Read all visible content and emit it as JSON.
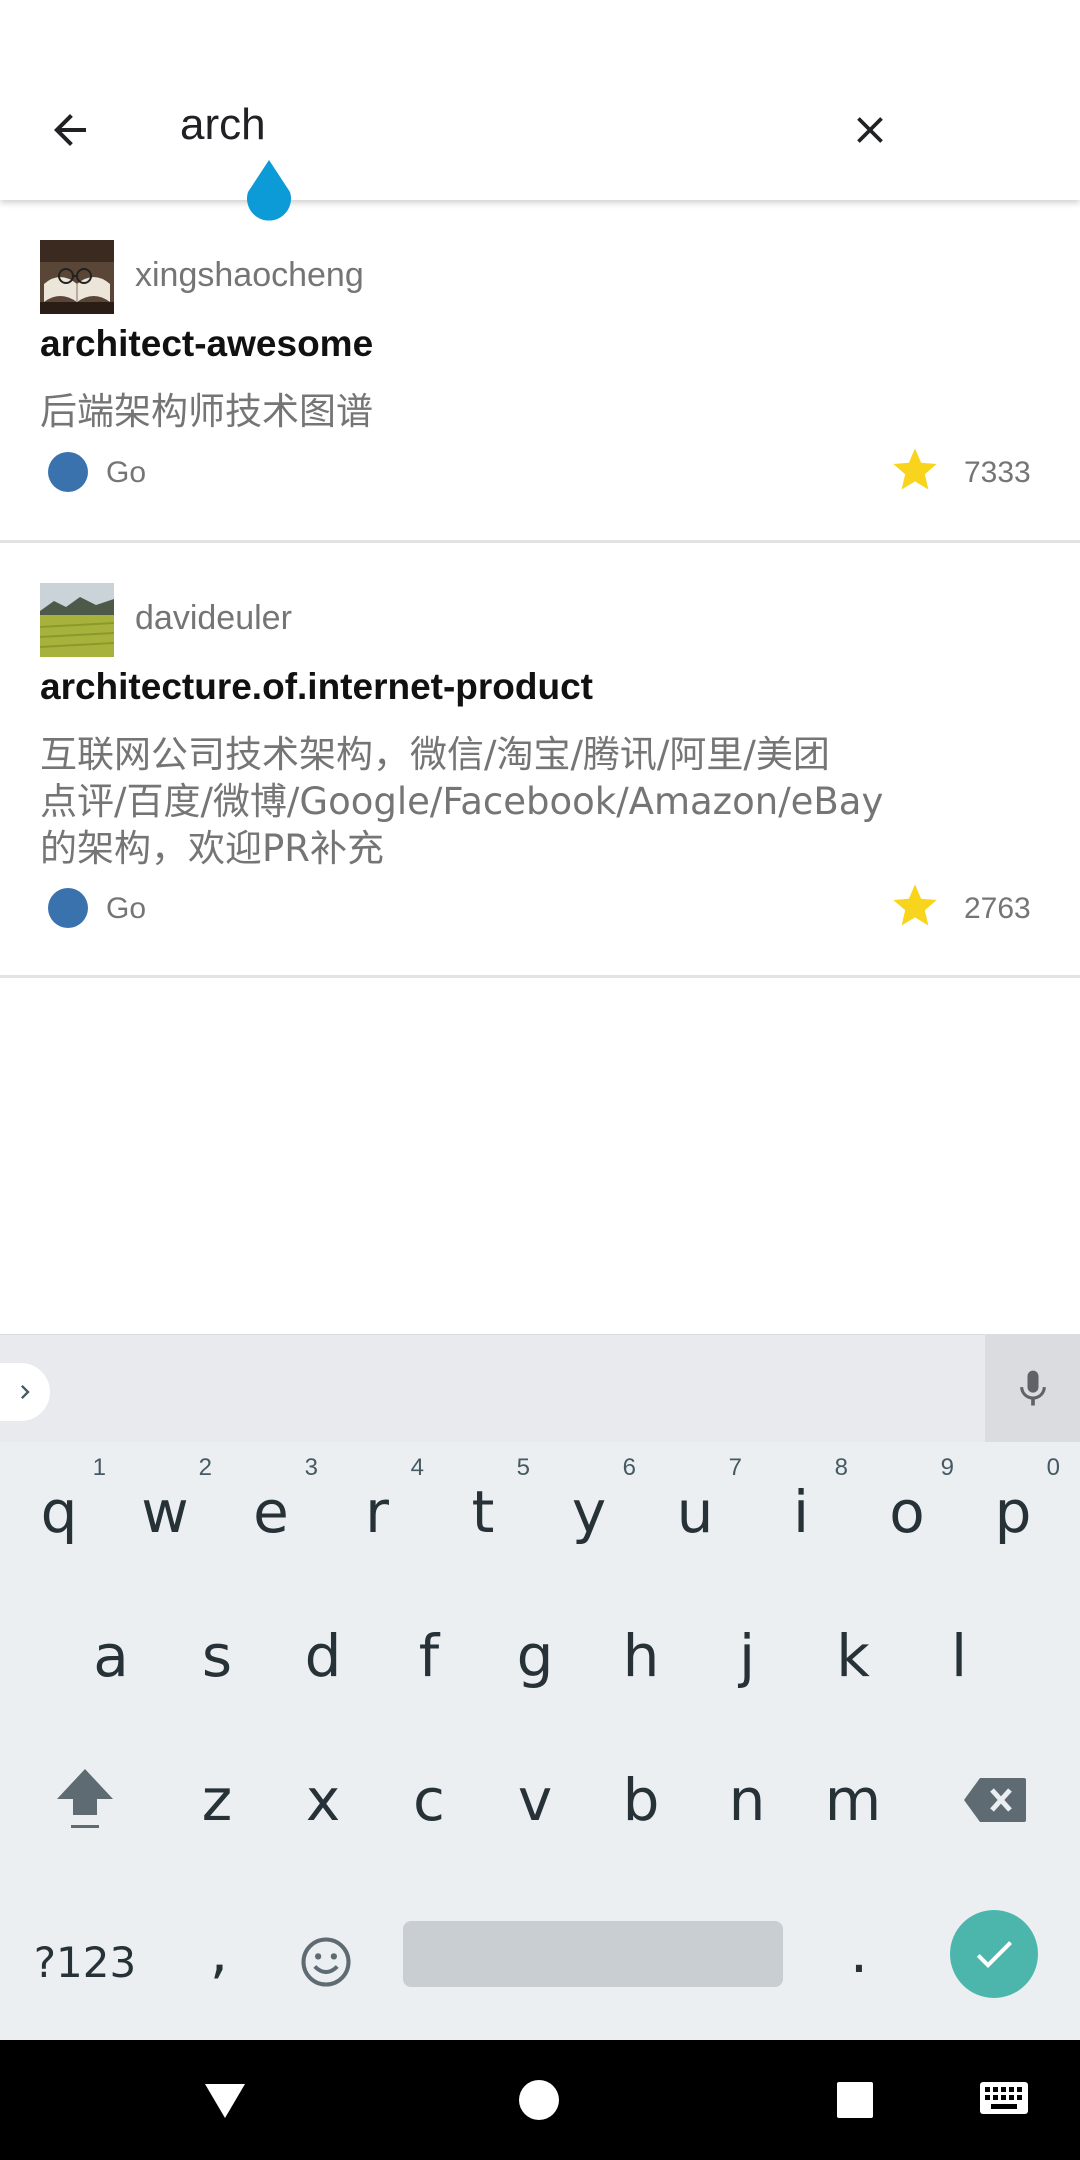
{
  "search": {
    "query": "arch"
  },
  "results": [
    {
      "owner": "xingshaocheng",
      "name": "architect-awesome",
      "description": "后端架构师技术图谱",
      "language": "Go",
      "language_color": "#3a72ae",
      "stars": "7333"
    },
    {
      "owner": "davideuler",
      "name": "architecture.of.internet-product",
      "description": "互联网公司技术架构，微信/淘宝/腾讯/阿里/美团点评/百度/微博/Google/Facebook/Amazon/eBay的架构，欢迎PR补充",
      "description_lines": [
        "互联网公司技术架构，微信/淘宝/腾讯/阿里/美团",
        "点评/百度/微博/Google/Facebook/Amazon/eBay",
        "的架构，欢迎PR补充"
      ],
      "language": "Go",
      "language_color": "#3a72ae",
      "stars": "2763"
    }
  ],
  "keyboard": {
    "row1": [
      {
        "key": "q",
        "hint": "1"
      },
      {
        "key": "w",
        "hint": "2"
      },
      {
        "key": "e",
        "hint": "3"
      },
      {
        "key": "r",
        "hint": "4"
      },
      {
        "key": "t",
        "hint": "5"
      },
      {
        "key": "y",
        "hint": "6"
      },
      {
        "key": "u",
        "hint": "7"
      },
      {
        "key": "i",
        "hint": "8"
      },
      {
        "key": "o",
        "hint": "9"
      },
      {
        "key": "p",
        "hint": "0"
      }
    ],
    "row2": [
      "a",
      "s",
      "d",
      "f",
      "g",
      "h",
      "j",
      "k",
      "l"
    ],
    "row3": [
      "z",
      "x",
      "c",
      "v",
      "b",
      "n",
      "m"
    ],
    "symbols_label": "?123",
    "comma": ",",
    "period": ".",
    "accent_color": "#4db6ac"
  },
  "colors": {
    "cursor_handle": "#0d9bd8",
    "star": "#f8d41c"
  },
  "icons": {
    "back": "arrow-left-icon",
    "clear": "close-icon",
    "star": "star-icon",
    "mic": "mic-icon",
    "shift": "shift-icon",
    "backspace": "backspace-icon",
    "emoji": "emoji-icon",
    "enter": "check-icon",
    "nav_back": "nav-back-icon",
    "nav_home": "nav-home-icon",
    "nav_recents": "nav-recents-icon",
    "nav_keyboard": "keyboard-icon"
  }
}
